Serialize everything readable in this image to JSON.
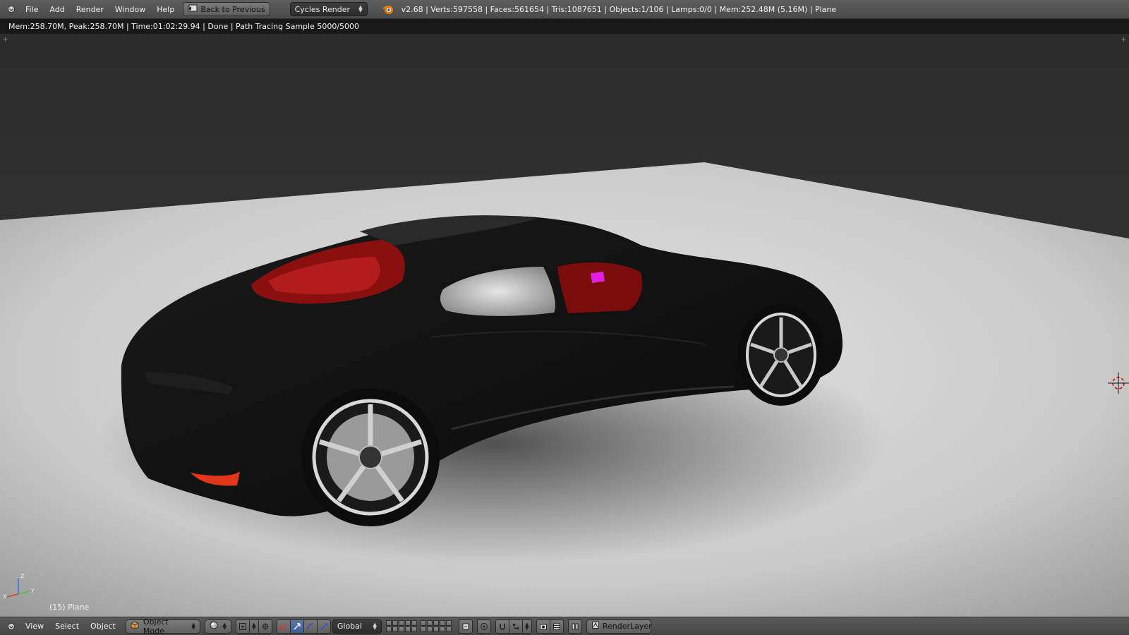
{
  "top_header": {
    "menu": [
      "File",
      "Add",
      "Render",
      "Window",
      "Help"
    ],
    "back_button": "Back to Previous",
    "render_engine": "Cycles Render",
    "stats": "v2.68 | Verts:597558 | Faces:561654 | Tris:1087651 | Objects:1/106 | Lamps:0/0 | Mem:252.48M (5.16M) | Plane"
  },
  "render_status": "Mem:258.70M, Peak:258.70M | Time:01:02:29.94 | Done | Path Tracing Sample 5000/5000",
  "viewport": {
    "object_label": "(15) Plane",
    "axes": {
      "x": "X",
      "y": "Y",
      "z": "Z"
    }
  },
  "bottom_header": {
    "menu": [
      "View",
      "Select",
      "Object"
    ],
    "mode": "Object Mode",
    "orientation": "Global",
    "render_layer": "RenderLayer"
  },
  "colors": {
    "header_bg": "#525252",
    "status_bg": "#191919",
    "accent_active": "#4a6ea0",
    "car_interior": "#b01a1a"
  }
}
